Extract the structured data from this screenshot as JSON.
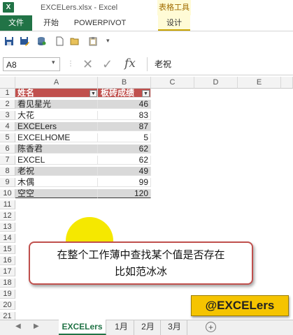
{
  "window": {
    "title": "EXCELers.xlsx - Excel",
    "app_icon": "X"
  },
  "ribbon": {
    "tabs": [
      "文件",
      "开始",
      "POWERPIVOT",
      "设计"
    ],
    "contextual_group": "表格工具"
  },
  "qat": {
    "icons": [
      "save-icon",
      "save-as-icon",
      "database-icon",
      "new-file-icon",
      "open-folder-icon",
      "clipboard-icon",
      "dropdown-icon"
    ]
  },
  "formula_bar": {
    "name_box": "A8",
    "fx_symbol": "fx",
    "content": "老祝"
  },
  "grid": {
    "columns": [
      "A",
      "B",
      "C",
      "D",
      "E"
    ],
    "rows": [
      "1",
      "2",
      "3",
      "4",
      "5",
      "6",
      "7",
      "8",
      "9",
      "10",
      "11",
      "12",
      "13",
      "14",
      "15",
      "16",
      "17",
      "18",
      "19",
      "20",
      "21"
    ],
    "table": {
      "headers": [
        "姓名",
        "板砖成绩"
      ],
      "records": [
        {
          "name": "看见星光",
          "score": "46"
        },
        {
          "name": "大花",
          "score": "83"
        },
        {
          "name": "EXCELers",
          "score": "87"
        },
        {
          "name": "EXCELHOME",
          "score": "5"
        },
        {
          "name": "陈香君",
          "score": "62"
        },
        {
          "name": "EXCEL",
          "score": "62"
        },
        {
          "name": "老祝",
          "score": "49"
        },
        {
          "name": "木偶",
          "score": "99"
        },
        {
          "name": "空空",
          "score": "120"
        }
      ]
    }
  },
  "annotations": {
    "callout_line1": "在整个工作薄中查找某个值是否存在",
    "callout_line2": "比如范冰冰",
    "badge": "@EXCELers"
  },
  "sheets": {
    "tabs": [
      "EXCELers",
      "1月",
      "2月",
      "3月"
    ],
    "active": "EXCELers",
    "add_symbol": "+"
  },
  "colors": {
    "excel_green": "#217346",
    "table_header": "#c0504d",
    "band": "#d9d9d9",
    "highlight": "#f5e800",
    "badge": "#f5c400"
  }
}
